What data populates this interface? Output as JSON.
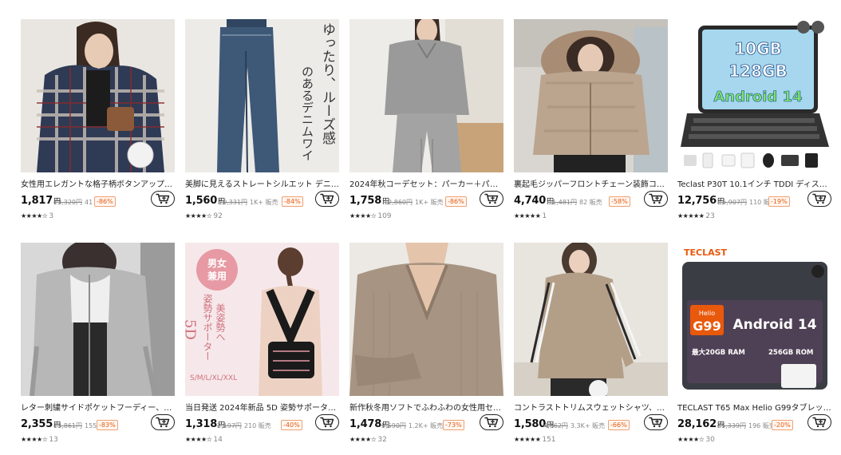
{
  "products": [
    {
      "title": "女性用エレガントな格子柄ボタンアップシャツ ...",
      "price": "1,817",
      "yen": "円",
      "orig": "13,320円",
      "sold": "41 販売",
      "discount": "-86%",
      "stars": "★★★★☆",
      "reviews": "3",
      "image": "plaid-shirt-woman"
    },
    {
      "title": "美脚に見えるストレートシルエット デニムパンツ ...",
      "price": "1,560",
      "yen": "円",
      "orig": "10,331円",
      "sold": "1K+ 販売",
      "discount": "-84%",
      "stars": "★★★★☆",
      "reviews": "92",
      "image": "denim-pants",
      "image_text": {
        "line1": "ゆったり、ルーズ感",
        "line2": "のあるデニムワイ"
      }
    },
    {
      "title": "2024年秋コーデセット：パーカー＋パンツ, 無...",
      "price": "1,758",
      "yen": "円",
      "orig": "12,860円",
      "sold": "1K+ 販売",
      "discount": "-86%",
      "stars": "★★★★☆",
      "reviews": "109",
      "image": "grey-knit-set"
    },
    {
      "title": "裏起毛ジッパーフロントチェーン装飾コート、エ...",
      "price": "4,740",
      "yen": "円",
      "orig": "11,481円",
      "sold": "82 販売",
      "discount": "-58%",
      "stars": "★★★★★",
      "reviews": "1",
      "image": "fur-hood-coat"
    },
    {
      "title": "Teclast P30T 10.1インチ TDDI ディスプレイ...",
      "price": "12,756",
      "yen": "円",
      "orig": "15,907円",
      "sold": "110 販売",
      "discount": "-19%",
      "stars": "★★★★★",
      "reviews": "23",
      "image": "tablet-keyboard",
      "image_text": {
        "ram": "10GB",
        "storage": "128GB",
        "os": "Android 14"
      }
    },
    {
      "title": "レター刺繍サイドポケットフーディー、ヴィンテ...",
      "price": "2,355",
      "yen": "円",
      "orig": "13,861円",
      "sold": "155 販売",
      "discount": "-83%",
      "stars": "★★★★☆",
      "reviews": "13",
      "image": "grey-hoodie"
    },
    {
      "title": "当日発送 2024年新品 5D 姿勢サポーター ...",
      "price": "1,318",
      "yen": "円",
      "orig": "2,197円",
      "sold": "210 販売",
      "discount": "-40%",
      "stars": "★★★★☆",
      "reviews": "14",
      "image": "posture-corrector",
      "image_text": {
        "badge1": "男女",
        "badge2": "兼用",
        "v1": "姿勢サポーター",
        "v2": "美姿勢へ",
        "d5": "5D",
        "sizes": "S/M/L/XL/XXL"
      }
    },
    {
      "title": "新作秋冬用ソフトでふわふわの女性用セータ...",
      "price": "1,478",
      "yen": "円",
      "orig": "5,590円",
      "sold": "1.2K+ 販売",
      "discount": "-73%",
      "stars": "★★★★☆",
      "reviews": "32",
      "image": "beige-sweater"
    },
    {
      "title": "コントラストトリムスウェットシャツ、クルーネック...",
      "price": "1,580",
      "yen": "円",
      "orig": "4,662円",
      "sold": "3.3K+ 販売",
      "discount": "-66%",
      "stars": "★★★★★",
      "reviews": "151",
      "image": "striped-sweatshirt"
    },
    {
      "title": "TECLAST T65 Max Helio G99タブレット An...",
      "price": "28,162",
      "yen": "円",
      "orig": "35,339円",
      "sold": "196 販売",
      "discount": "-20%",
      "stars": "★★★★☆",
      "reviews": "30",
      "image": "teclast-tablet",
      "image_text": {
        "brand": "TECLAST",
        "chip_top": "Helio",
        "chip": "G99",
        "os": "Android 14",
        "ram": "最大20GB RAM",
        "rom": "256GB ROM"
      }
    }
  ],
  "colors": {
    "discount": "#e8590c",
    "text": "#222222",
    "muted": "#888888"
  }
}
